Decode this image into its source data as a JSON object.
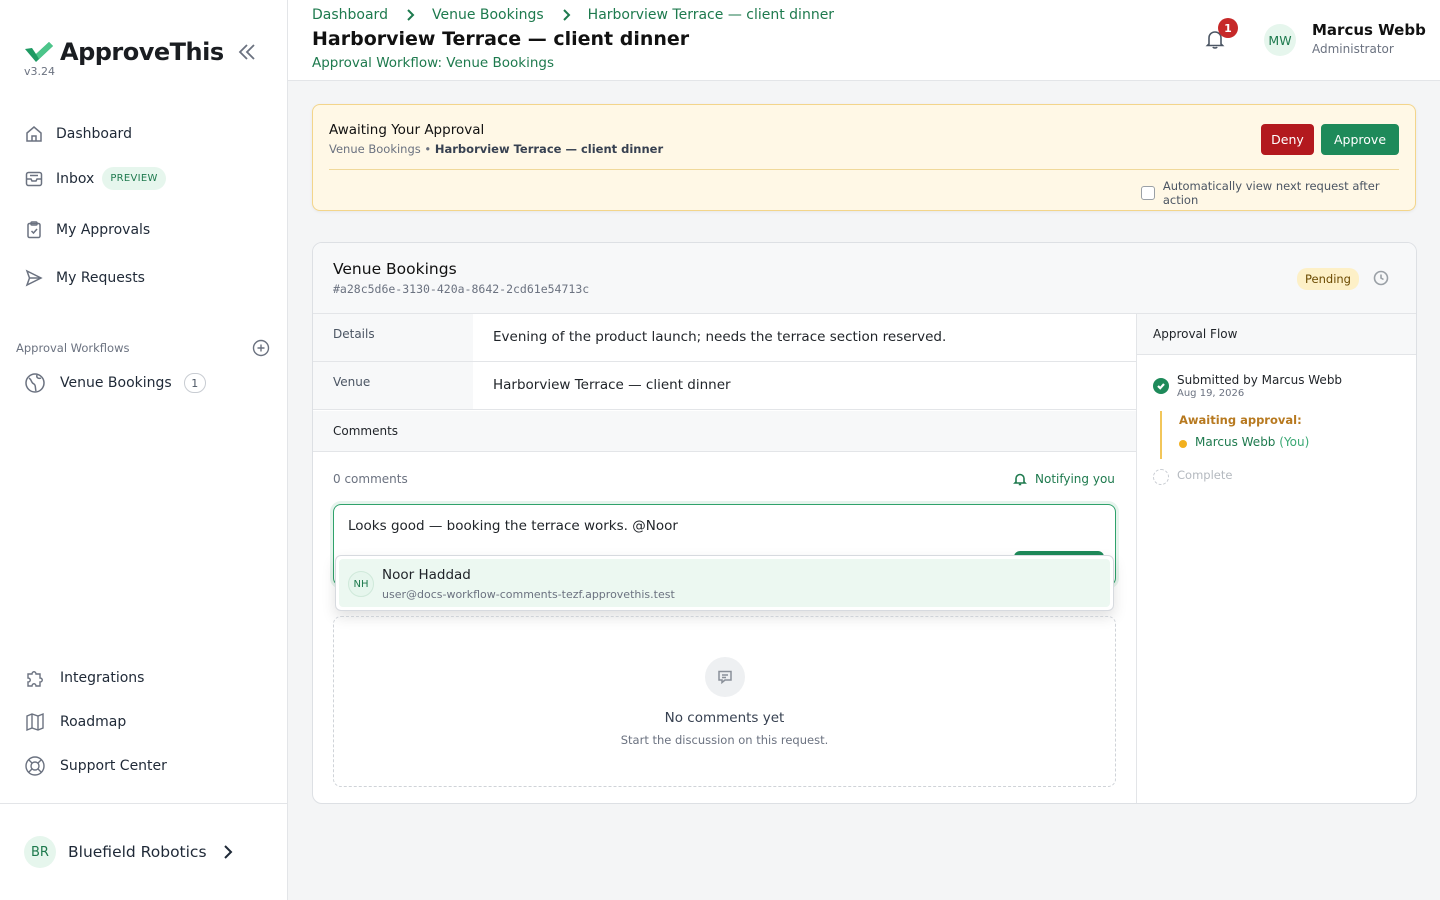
{
  "app": {
    "name": "ApproveThis",
    "version": "v3.24",
    "brand_color": "#1e8a5a"
  },
  "sidebar": {
    "nav": [
      {
        "label": "Dashboard",
        "icon": "home-icon"
      },
      {
        "label": "Inbox",
        "icon": "inbox-icon",
        "badge": "PREVIEW"
      },
      {
        "label": "My Approvals",
        "icon": "clipboard-check-icon"
      },
      {
        "label": "My Requests",
        "icon": "send-icon"
      }
    ],
    "workflows_label": "Approval Workflows",
    "workflows": [
      {
        "label": "Venue Bookings",
        "count": "1",
        "icon": "globe-icon"
      }
    ],
    "bottom_nav": [
      {
        "label": "Integrations",
        "icon": "puzzle-icon"
      },
      {
        "label": "Roadmap",
        "icon": "map-icon"
      },
      {
        "label": "Support Center",
        "icon": "lifebuoy-icon"
      }
    ],
    "org": {
      "initials": "BR",
      "name": "Bluefield Robotics"
    }
  },
  "header": {
    "breadcrumb": [
      "Dashboard",
      "Venue Bookings",
      "Harborview Terrace — client dinner"
    ],
    "title": "Harborview Terrace — client dinner",
    "subtitle": "Approval Workflow: Venue Bookings",
    "notification_count": "1",
    "user": {
      "initials": "MW",
      "name": "Marcus Webb",
      "role": "Administrator"
    }
  },
  "awaiting": {
    "title": "Awaiting Your Approval",
    "sub_workflow": "Venue Bookings",
    "sub_separator": "•",
    "sub_request": "Harborview Terrace — client dinner",
    "deny_label": "Deny",
    "approve_label": "Approve",
    "auto_next_label": "Automatically view next request after action",
    "auto_next_checked": false
  },
  "request": {
    "workflow": "Venue Bookings",
    "id": "#a28c5d6e-3130-420a-8642-2cd61e54713c",
    "status": "Pending",
    "fields": [
      {
        "label": "Details",
        "value": "Evening of the product launch; needs the terrace section reserved."
      },
      {
        "label": "Venue",
        "value": "Harborview Terrace — client dinner"
      }
    ],
    "comments": {
      "header": "Comments",
      "count_text": "0 comments",
      "notify_text": "Notifying you",
      "draft": "Looks good — booking the terrace works. @Noor",
      "mention": {
        "initials": "NH",
        "name": "Noor Haddad",
        "email": "user@docs-workflow-comments-tezf.approvethis.test"
      },
      "empty_title": "No comments yet",
      "empty_sub": "Start the discussion on this request."
    },
    "flow": {
      "header": "Approval Flow",
      "submitted": "Submitted by Marcus Webb",
      "submitted_date": "Aug 19, 2026",
      "awaiting_label": "Awaiting approval:",
      "approver": "Marcus Webb",
      "approver_suffix": "(You)",
      "complete_label": "Complete"
    }
  }
}
